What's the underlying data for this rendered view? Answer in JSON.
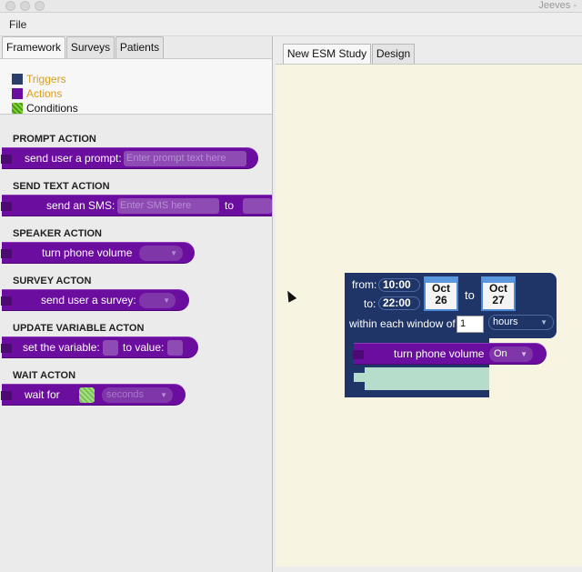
{
  "window": {
    "title": "Jeeves -"
  },
  "menu": {
    "file": "File"
  },
  "left_tabs": [
    "Framework",
    "Surveys",
    "Patients"
  ],
  "legend": [
    {
      "label": "Triggers",
      "color": "#2b3f6e",
      "text_color": "#d99d1a"
    },
    {
      "label": "Actions",
      "color": "#6b0d9e",
      "text_color": "#d99d1a"
    },
    {
      "label": "Conditions",
      "color": "#5bb51a",
      "text_color": "#111111"
    }
  ],
  "sections": [
    {
      "title": "PROMPT ACTION",
      "text": "send user a prompt:",
      "field_placeholder": "Enter prompt text here"
    },
    {
      "title": "SEND TEXT ACTION",
      "text": "send an SMS:",
      "field_placeholder": "Enter SMS here",
      "to_label": "to"
    },
    {
      "title": "SPEAKER ACTION",
      "text": "turn phone volume"
    },
    {
      "title": "SURVEY ACTON",
      "text": "send user a survey:"
    },
    {
      "title": "UPDATE VARIABLE ACTON",
      "text": "set the variable:",
      "text2": "to value:"
    },
    {
      "title": "WAIT ACTON",
      "text": "wait for",
      "dropdown": "seconds"
    }
  ],
  "right_tabs": [
    "New ESM Study",
    "Design"
  ],
  "trigger": {
    "from_label": "from:",
    "from_time": "10:00",
    "to_time_label": "to:",
    "to_time": "22:00",
    "date_from": {
      "month": "Oct",
      "day": "26"
    },
    "to_word": "to",
    "date_to": {
      "month": "Oct",
      "day": "27"
    },
    "window_label": "within each window of",
    "window_value": "1",
    "unit": "hours",
    "action_text": "turn phone volume",
    "action_value": "On"
  }
}
